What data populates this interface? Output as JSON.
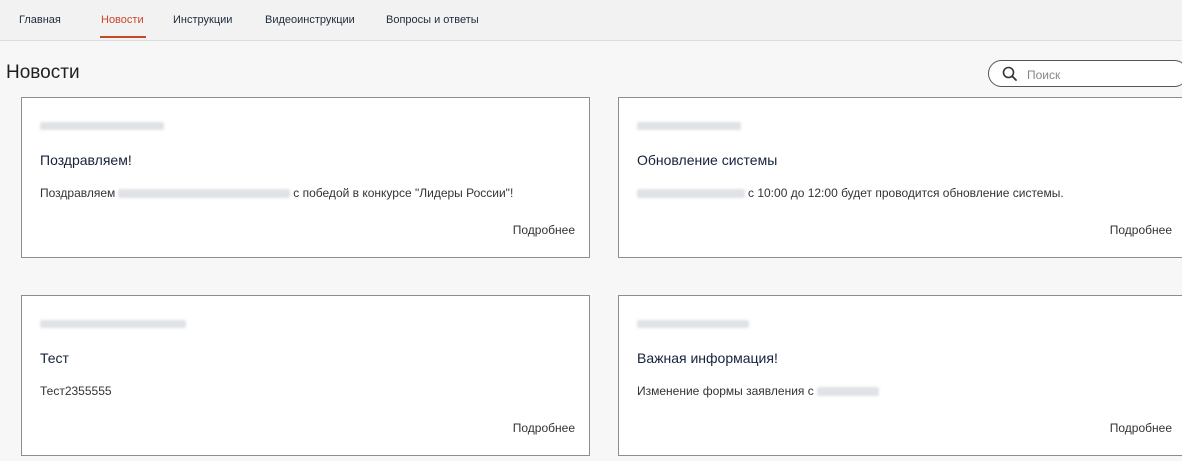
{
  "nav": {
    "items": [
      "Главная",
      "Новости",
      "Инструкции",
      "Видеоинструкции",
      "Вопросы и ответы"
    ],
    "active": "Новости",
    "accent_color": "#c8462a"
  },
  "page": {
    "title": "Новости"
  },
  "search": {
    "placeholder": "Поиск",
    "icon": "search-icon"
  },
  "cards": [
    {
      "title": "Поздравляем!",
      "body_before": "Поздравляем",
      "body_after": "с победой в конкурсе \"Лидеры России\"!",
      "more": "Подробнее"
    },
    {
      "title": "Обновление системы",
      "body_before": "",
      "body_after": "с 10:00 до 12:00 будет проводится обновление системы.",
      "more": "Подробнее"
    },
    {
      "title": "Тест",
      "body_before": "Тест2355555",
      "body_after": "",
      "more": "Подробнее"
    },
    {
      "title": "Важная информация!",
      "body_before": "Изменение формы заявления с",
      "body_after": "",
      "more": "Подробнее"
    }
  ]
}
